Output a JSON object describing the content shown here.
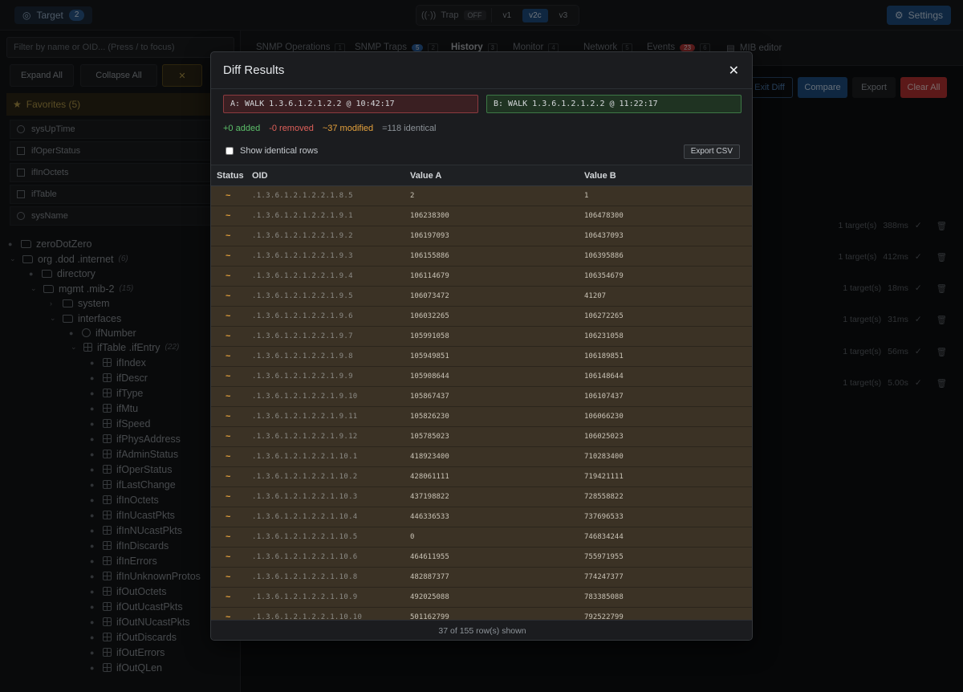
{
  "topbar": {
    "target_label": "Target",
    "target_count": "2",
    "trap_label": "Trap",
    "trap_state": "OFF",
    "versions": [
      "v1",
      "v2c",
      "v3"
    ],
    "settings_label": "Settings"
  },
  "sidebar": {
    "filter_placeholder": "Filter by name or OID... (Press / to focus)",
    "expand_all": "Expand All",
    "collapse_all": "Collapse All",
    "favorites_title": "Favorites (5)",
    "favorites": [
      "sysUpTime",
      "ifOperStatus",
      "ifInOctets",
      "ifTable",
      "sysName"
    ],
    "tree": {
      "zero": "zeroDotZero",
      "org": "org .dod .internet",
      "org_count": "(6)",
      "directory": "directory",
      "mgmt": "mgmt .mib-2",
      "mgmt_count": "(15)",
      "system": "system",
      "interfaces": "interfaces",
      "ifnumber": "ifNumber",
      "iftable": "ifTable .ifEntry",
      "iftable_count": "(22)",
      "entries": [
        "ifIndex",
        "ifDescr",
        "ifType",
        "ifMtu",
        "ifSpeed",
        "ifPhysAddress",
        "ifAdminStatus",
        "ifOperStatus",
        "ifLastChange",
        "ifInOctets",
        "ifInUcastPkts",
        "ifInNUcastPkts",
        "ifInDiscards",
        "ifInErrors",
        "ifInUnknownProtos",
        "ifOutOctets",
        "ifOutUcastPkts",
        "ifOutNUcastPkts",
        "ifOutDiscards",
        "ifOutErrors",
        "ifOutQLen"
      ]
    }
  },
  "tabs": {
    "ops": "SNMP Operations",
    "ops_key": "1",
    "traps": "SNMP Traps",
    "traps_count": "5",
    "traps_key": "2",
    "history": "History",
    "history_key": "3",
    "monitor": "Monitor",
    "monitor_key": "4",
    "network": "Network",
    "network_key": "5",
    "events": "Events",
    "events_count": "23",
    "events_key": "6",
    "mib": "MIB editor"
  },
  "history_toolbar": {
    "exit_diff": "Exit Diff",
    "compare": "Compare",
    "export": "Export",
    "clear_all": "Clear All"
  },
  "history_rows": [
    {
      "targets": "1 target(s)",
      "time": "388ms"
    },
    {
      "targets": "1 target(s)",
      "time": "412ms"
    },
    {
      "targets": "1 target(s)",
      "time": "18ms"
    },
    {
      "targets": "1 target(s)",
      "time": "31ms"
    },
    {
      "targets": "1 target(s)",
      "time": "56ms"
    },
    {
      "targets": "1 target(s)",
      "time": "5.00s"
    }
  ],
  "modal": {
    "title": "Diff Results",
    "walk_a": "A: WALK 1.3.6.1.2.1.2.2 @ 10:42:17",
    "walk_b": "B: WALK 1.3.6.1.2.1.2.2 @ 11:22:17",
    "added": "+0 added",
    "removed": "-0 removed",
    "modified": "~37 modified",
    "identical": "=118 identical",
    "show_identical": "Show identical rows",
    "export_csv": "Export CSV",
    "columns": [
      "Status",
      "OID",
      "Value A",
      "Value B"
    ],
    "footer": "37 of 155 row(s) shown",
    "rows": [
      {
        "status": "~",
        "oid": ".1.3.6.1.2.1.2.2.1.8.5",
        "a": "2",
        "b": "1"
      },
      {
        "status": "~",
        "oid": ".1.3.6.1.2.1.2.2.1.9.1",
        "a": "106238300",
        "b": "106478300"
      },
      {
        "status": "~",
        "oid": ".1.3.6.1.2.1.2.2.1.9.2",
        "a": "106197093",
        "b": "106437093"
      },
      {
        "status": "~",
        "oid": ".1.3.6.1.2.1.2.2.1.9.3",
        "a": "106155886",
        "b": "106395886"
      },
      {
        "status": "~",
        "oid": ".1.3.6.1.2.1.2.2.1.9.4",
        "a": "106114679",
        "b": "106354679"
      },
      {
        "status": "~",
        "oid": ".1.3.6.1.2.1.2.2.1.9.5",
        "a": "106073472",
        "b": "41207"
      },
      {
        "status": "~",
        "oid": ".1.3.6.1.2.1.2.2.1.9.6",
        "a": "106032265",
        "b": "106272265"
      },
      {
        "status": "~",
        "oid": ".1.3.6.1.2.1.2.2.1.9.7",
        "a": "105991058",
        "b": "106231058"
      },
      {
        "status": "~",
        "oid": ".1.3.6.1.2.1.2.2.1.9.8",
        "a": "105949851",
        "b": "106189851"
      },
      {
        "status": "~",
        "oid": ".1.3.6.1.2.1.2.2.1.9.9",
        "a": "105908644",
        "b": "106148644"
      },
      {
        "status": "~",
        "oid": ".1.3.6.1.2.1.2.2.1.9.10",
        "a": "105867437",
        "b": "106107437"
      },
      {
        "status": "~",
        "oid": ".1.3.6.1.2.1.2.2.1.9.11",
        "a": "105826230",
        "b": "106066230"
      },
      {
        "status": "~",
        "oid": ".1.3.6.1.2.1.2.2.1.9.12",
        "a": "105785023",
        "b": "106025023"
      },
      {
        "status": "~",
        "oid": ".1.3.6.1.2.1.2.2.1.10.1",
        "a": "418923400",
        "b": "710283400"
      },
      {
        "status": "~",
        "oid": ".1.3.6.1.2.1.2.2.1.10.2",
        "a": "428061111",
        "b": "719421111"
      },
      {
        "status": "~",
        "oid": ".1.3.6.1.2.1.2.2.1.10.3",
        "a": "437198822",
        "b": "728558822"
      },
      {
        "status": "~",
        "oid": ".1.3.6.1.2.1.2.2.1.10.4",
        "a": "446336533",
        "b": "737696533"
      },
      {
        "status": "~",
        "oid": ".1.3.6.1.2.1.2.2.1.10.5",
        "a": "0",
        "b": "746834244"
      },
      {
        "status": "~",
        "oid": ".1.3.6.1.2.1.2.2.1.10.6",
        "a": "464611955",
        "b": "755971955"
      },
      {
        "status": "~",
        "oid": ".1.3.6.1.2.1.2.2.1.10.8",
        "a": "482887377",
        "b": "774247377"
      },
      {
        "status": "~",
        "oid": ".1.3.6.1.2.1.2.2.1.10.9",
        "a": "492025088",
        "b": "783385088"
      },
      {
        "status": "~",
        "oid": ".1.3.6.1.2.1.2.2.1.10.10",
        "a": "501162799",
        "b": "792522799"
      }
    ]
  }
}
